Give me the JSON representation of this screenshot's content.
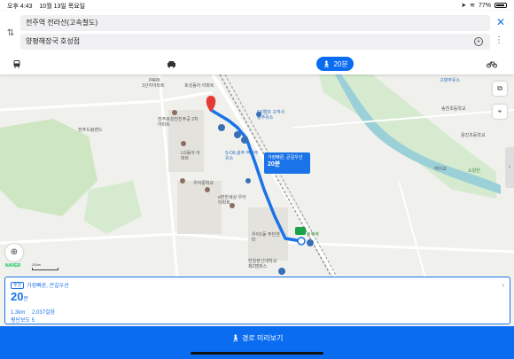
{
  "status": {
    "time": "오후 4:43",
    "date": "10월 13일 목요일",
    "battery": "77%"
  },
  "search": {
    "origin": "전주역 전라선(고속철도)",
    "destination": "양평해장국 호성점"
  },
  "modes": {
    "walk_label": "20분"
  },
  "map": {
    "labels": [
      "PARK",
      "호성동아 아파트",
      "1단지아파트",
      "전주호성전진주공 2차아파트",
      "LG동아 아파트",
      "우아중학교",
      "e편한세상 우아아파트",
      "SK엘피 고객사랑주유소",
      "S-OIL광주 역전주유소",
      "우아1동 주민센터",
      "한일장신대학교 제2캠퍼스",
      "전주역",
      "전주드림랜드",
      "고향주유소",
      "송천초등학교",
      "용진초등학교",
      "하이교",
      "소양천"
    ],
    "scale": "200m",
    "logo": "NAVER",
    "callout_tag": "가장빠른, 큰길우선",
    "callout_time": "20분"
  },
  "card": {
    "badge": "추천",
    "tag": "가장빠른, 큰길우선",
    "time_value": "20",
    "time_unit": "분",
    "distance": "1.3km",
    "steps": "2,037걸음",
    "crosswalk": "횡단보도 5"
  },
  "bottom": {
    "preview_label": "경로 미리보기"
  },
  "colors": {
    "accent": "#1a73e8",
    "bottom_bar": "#0a6cf0"
  }
}
